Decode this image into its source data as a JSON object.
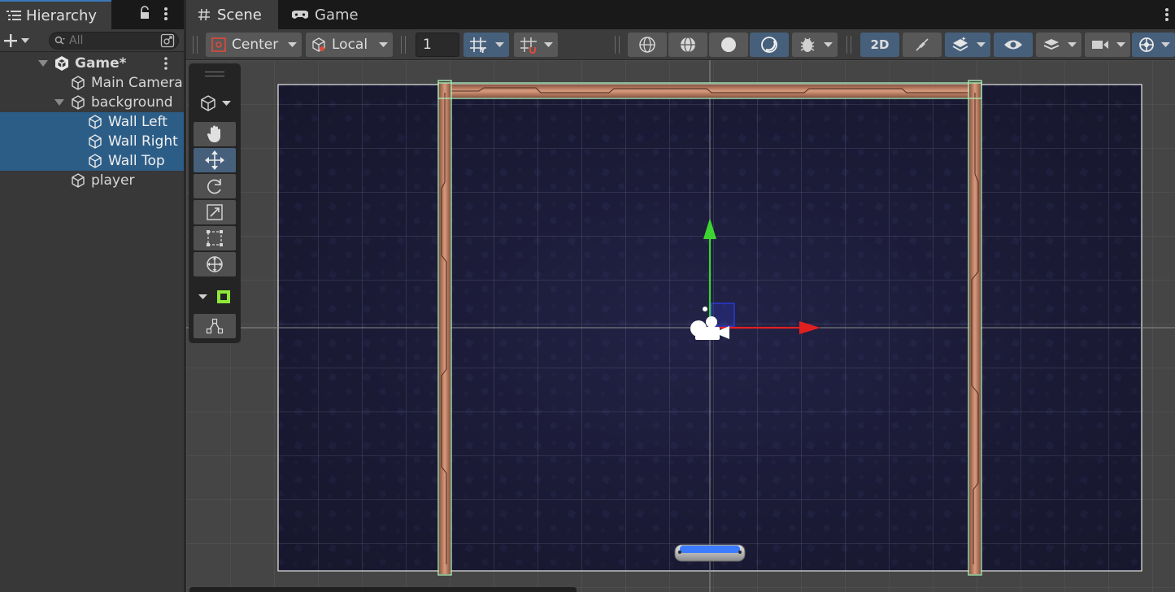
{
  "hierarchy": {
    "tab_label": "Hierarchy",
    "search_placeholder": "All",
    "scene_name": "Game*",
    "items": [
      {
        "label": "Main Camera",
        "depth": 1,
        "selected": false
      },
      {
        "label": "background",
        "depth": 1,
        "selected": false,
        "expanded": true
      },
      {
        "label": "Wall Left",
        "depth": 2,
        "selected": true
      },
      {
        "label": "Wall Right",
        "depth": 2,
        "selected": true
      },
      {
        "label": "Wall Top",
        "depth": 2,
        "selected": true
      },
      {
        "label": "player",
        "depth": 1,
        "selected": false
      }
    ]
  },
  "scene": {
    "tabs": [
      {
        "label": "Scene",
        "icon": "hash-icon"
      },
      {
        "label": "Game",
        "icon": "gamepad-icon"
      }
    ],
    "toolbar": {
      "pivot_mode": "Center",
      "pivot_rotation": "Local",
      "grid_snap_value": "1",
      "mode_2d": "2D"
    }
  },
  "colors": {
    "selection": "#2c5d87",
    "accent": "#3a79bb",
    "gizmo_x": "#e02020",
    "gizmo_y": "#3ed430",
    "gizmo_z": "#2a3ad8",
    "wall": "#c7866a",
    "background_sprite": "#1c1c3a",
    "paddle": "#3b7bff",
    "selection_outline": "#a8e8b0"
  }
}
